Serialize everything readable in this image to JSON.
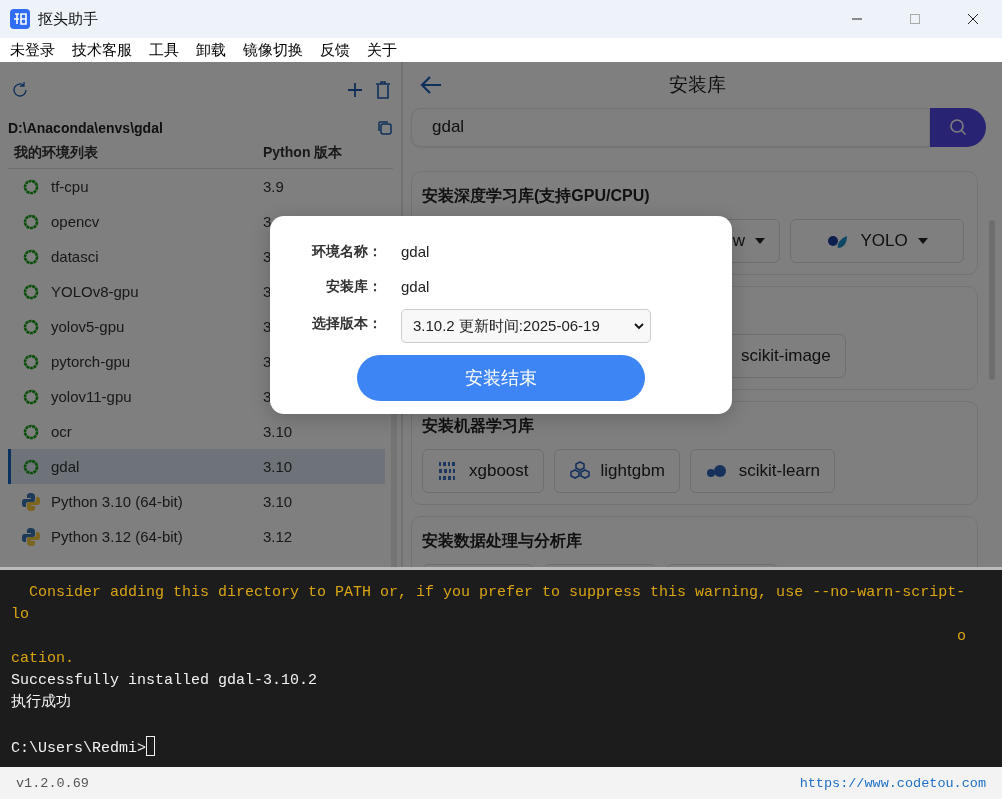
{
  "window": {
    "title": "抠头助手"
  },
  "menu": [
    "未登录",
    "技术客服",
    "工具",
    "卸载",
    "镜像切换",
    "反馈",
    "关于"
  ],
  "env_panel": {
    "path": "D:\\Anaconda\\envs\\gdal",
    "columns": [
      "我的环境列表",
      "Python 版本"
    ],
    "envs": [
      {
        "name": "tf-cpu",
        "version": "3.9",
        "kind": "conda",
        "selected": false
      },
      {
        "name": "opencv",
        "version": "3",
        "kind": "conda",
        "selected": false
      },
      {
        "name": "datasci",
        "version": "3",
        "kind": "conda",
        "selected": false
      },
      {
        "name": "YOLOv8-gpu",
        "version": "3",
        "kind": "conda",
        "selected": false
      },
      {
        "name": "yolov5-gpu",
        "version": "3",
        "kind": "conda",
        "selected": false
      },
      {
        "name": "pytorch-gpu",
        "version": "3",
        "kind": "conda",
        "selected": false
      },
      {
        "name": "yolov11-gpu",
        "version": "3",
        "kind": "conda",
        "selected": false
      },
      {
        "name": "ocr",
        "version": "3.10",
        "kind": "conda",
        "selected": false
      },
      {
        "name": "gdal",
        "version": "3.10",
        "kind": "conda",
        "selected": true
      },
      {
        "name": "Python 3.10 (64-bit)",
        "version": "3.10",
        "kind": "python",
        "selected": false
      },
      {
        "name": "Python 3.12 (64-bit)",
        "version": "3.12",
        "kind": "python",
        "selected": false
      }
    ]
  },
  "library_panel": {
    "title": "安装库",
    "search": {
      "value": "gdal"
    },
    "sections": [
      {
        "title": "安装深度学习库(支持GPU/CPU)",
        "buttons": [
          {
            "label": "w",
            "kind": "wide",
            "dropdown": true
          },
          {
            "label": "YOLO",
            "kind": "yolo",
            "dropdown": true
          }
        ]
      },
      {
        "buttons": [
          {
            "label": "scikit-image",
            "kind": "offset",
            "dropdown": false
          }
        ]
      },
      {
        "title": "安装机器学习库",
        "buttons": [
          {
            "label": "xgboost",
            "kind": "binary",
            "dropdown": false
          },
          {
            "label": "lightgbm",
            "kind": "cubes",
            "dropdown": false
          },
          {
            "label": "scikit-learn",
            "kind": "sklearn",
            "dropdown": false
          }
        ]
      },
      {
        "title": "安装数据处理与分析库",
        "buttons": [
          {
            "kind": "clipped"
          },
          {
            "kind": "clipped"
          },
          {
            "kind": "clipped"
          }
        ]
      }
    ]
  },
  "dialog": {
    "fields": [
      {
        "label": "环境名称：",
        "value": "gdal",
        "kind": "text"
      },
      {
        "label": "安装库：",
        "value": "gdal",
        "kind": "text"
      },
      {
        "label": "选择版本：",
        "value": "3.10.2 更新时间:2025-06-19",
        "kind": "select"
      }
    ],
    "button": "安装结束"
  },
  "terminal": {
    "lines": [
      {
        "text": "  Consider adding this directory to PATH or, if you prefer to suppress this warning, use --no-warn-script-",
        "kind": "warning"
      },
      {
        "text": "lo",
        "kind": "warning"
      },
      {
        "text": "o",
        "kind": "wrapped"
      },
      {
        "text": "cation.",
        "kind": "warning"
      },
      {
        "text": "Successfully installed gdal-3.10.2",
        "kind": "output"
      },
      {
        "text": "执行成功",
        "kind": "output"
      },
      {
        "kind": "blank"
      },
      {
        "text": "C:\\Users\\Redmi>",
        "kind": "prompt"
      }
    ]
  },
  "status_bar": {
    "version": "v1.2.0.69",
    "link": "https://www.codetou.com"
  }
}
